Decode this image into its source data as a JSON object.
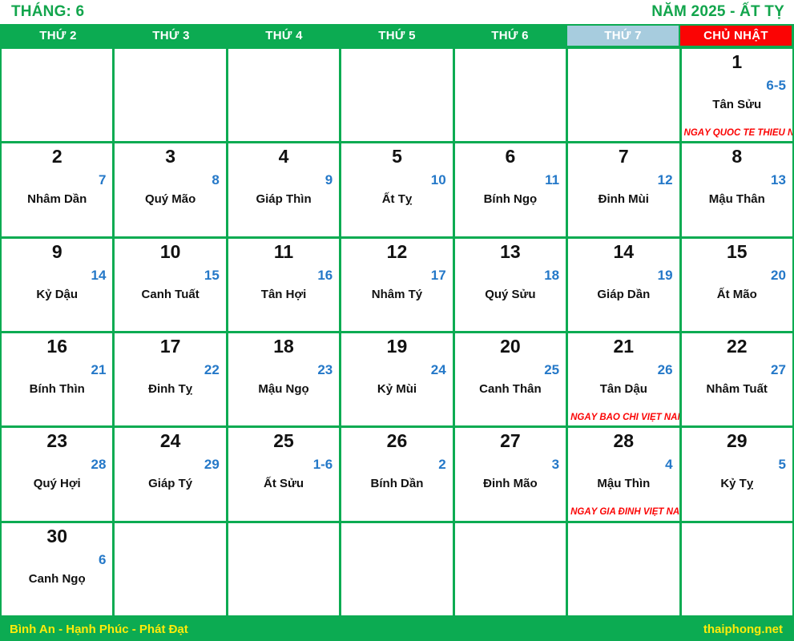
{
  "header": {
    "month_label": "THÁNG: 6",
    "year_label": "NĂM 2025 - ẤT TỴ"
  },
  "weekdays": [
    {
      "label": "THỨ 2",
      "kind": "weekday"
    },
    {
      "label": "THỨ 3",
      "kind": "weekday"
    },
    {
      "label": "THỨ 4",
      "kind": "weekday"
    },
    {
      "label": "THỨ 5",
      "kind": "weekday"
    },
    {
      "label": "THỨ 6",
      "kind": "weekday"
    },
    {
      "label": "THỨ 7",
      "kind": "saturday"
    },
    {
      "label": "CHỦ NHẬT",
      "kind": "sunday"
    }
  ],
  "weeks": [
    [
      {
        "empty": true
      },
      {
        "empty": true
      },
      {
        "empty": true
      },
      {
        "empty": true
      },
      {
        "empty": true
      },
      {
        "empty": true
      },
      {
        "solar": "1",
        "lunar": "6-5",
        "canchi": "Tân Sửu",
        "event": "NGÀY QUỐC TẾ THIẾU NHI"
      }
    ],
    [
      {
        "solar": "2",
        "lunar": "7",
        "canchi": "Nhâm Dần",
        "event": ""
      },
      {
        "solar": "3",
        "lunar": "8",
        "canchi": "Quý Mão",
        "event": ""
      },
      {
        "solar": "4",
        "lunar": "9",
        "canchi": "Giáp Thìn",
        "event": ""
      },
      {
        "solar": "5",
        "lunar": "10",
        "canchi": "Ất Tỵ",
        "event": ""
      },
      {
        "solar": "6",
        "lunar": "11",
        "canchi": "Bính Ngọ",
        "event": ""
      },
      {
        "solar": "7",
        "lunar": "12",
        "canchi": "Đinh Mùi",
        "event": ""
      },
      {
        "solar": "8",
        "lunar": "13",
        "canchi": "Mậu Thân",
        "event": ""
      }
    ],
    [
      {
        "solar": "9",
        "lunar": "14",
        "canchi": "Kỷ Dậu",
        "event": ""
      },
      {
        "solar": "10",
        "lunar": "15",
        "canchi": "Canh Tuất",
        "event": ""
      },
      {
        "solar": "11",
        "lunar": "16",
        "canchi": "Tân Hợi",
        "event": ""
      },
      {
        "solar": "12",
        "lunar": "17",
        "canchi": "Nhâm Tý",
        "event": ""
      },
      {
        "solar": "13",
        "lunar": "18",
        "canchi": "Quý Sửu",
        "event": ""
      },
      {
        "solar": "14",
        "lunar": "19",
        "canchi": "Giáp Dần",
        "event": ""
      },
      {
        "solar": "15",
        "lunar": "20",
        "canchi": "Ất Mão",
        "event": ""
      }
    ],
    [
      {
        "solar": "16",
        "lunar": "21",
        "canchi": "Bính Thìn",
        "event": ""
      },
      {
        "solar": "17",
        "lunar": "22",
        "canchi": "Đinh Tỵ",
        "event": ""
      },
      {
        "solar": "18",
        "lunar": "23",
        "canchi": "Mậu Ngọ",
        "event": ""
      },
      {
        "solar": "19",
        "lunar": "24",
        "canchi": "Kỷ Mùi",
        "event": ""
      },
      {
        "solar": "20",
        "lunar": "25",
        "canchi": "Canh Thân",
        "event": ""
      },
      {
        "solar": "21",
        "lunar": "26",
        "canchi": "Tân Dậu",
        "event": "NGÀY BÁO CHÍ VIỆT NAM"
      },
      {
        "solar": "22",
        "lunar": "27",
        "canchi": "Nhâm Tuất",
        "event": ""
      }
    ],
    [
      {
        "solar": "23",
        "lunar": "28",
        "canchi": "Quý Hợi",
        "event": ""
      },
      {
        "solar": "24",
        "lunar": "29",
        "canchi": "Giáp Tý",
        "event": ""
      },
      {
        "solar": "25",
        "lunar": "1-6",
        "canchi": "Ất Sửu",
        "event": ""
      },
      {
        "solar": "26",
        "lunar": "2",
        "canchi": "Bính Dần",
        "event": ""
      },
      {
        "solar": "27",
        "lunar": "3",
        "canchi": "Đinh Mão",
        "event": ""
      },
      {
        "solar": "28",
        "lunar": "4",
        "canchi": "Mậu Thìn",
        "event": "NGÀY GIA ĐÌNH VIỆT NAM"
      },
      {
        "solar": "29",
        "lunar": "5",
        "canchi": "Kỷ Tỵ",
        "event": ""
      }
    ],
    [
      {
        "solar": "30",
        "lunar": "6",
        "canchi": "Canh Ngọ",
        "event": ""
      },
      {
        "empty": true
      },
      {
        "empty": true
      },
      {
        "empty": true
      },
      {
        "empty": true
      },
      {
        "empty": true
      },
      {
        "empty": true
      }
    ]
  ],
  "footer": {
    "slogan": "Bình An - Hạnh Phúc - Phát Đạt",
    "site": "thaiphong.net"
  },
  "colors": {
    "green": "#0cab52",
    "title_green": "#12a54c",
    "red": "#fb0404",
    "blue": "#2478c8",
    "yellow": "#ffeb0a",
    "saturday_blue": "#a7ccde"
  }
}
